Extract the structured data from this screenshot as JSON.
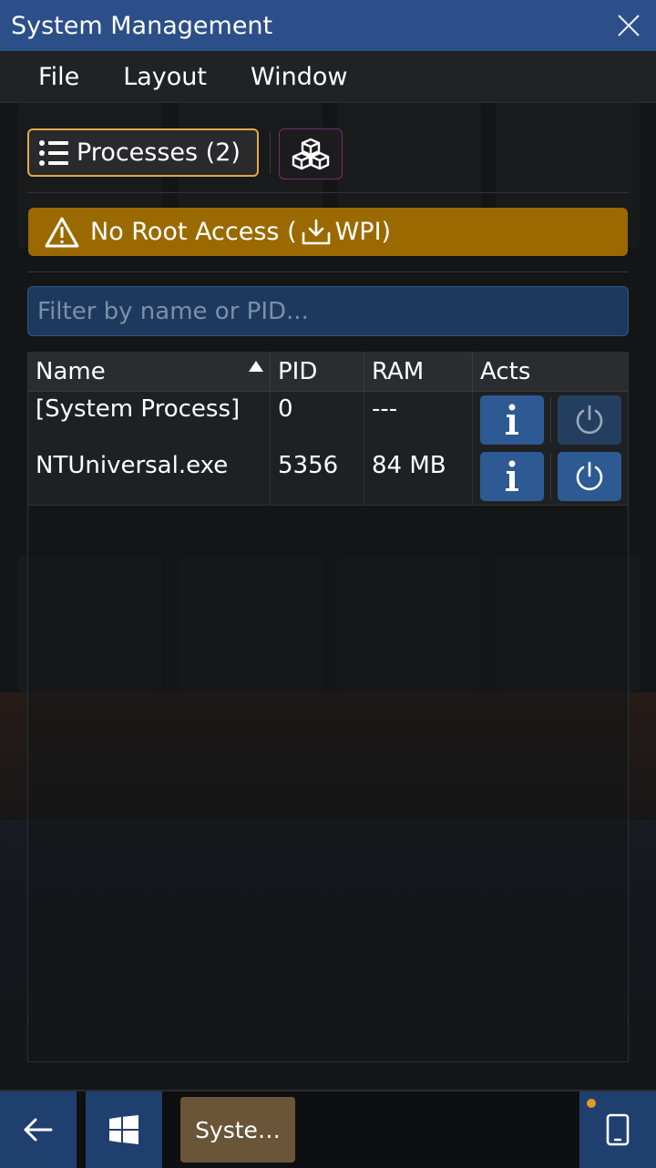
{
  "window": {
    "title": "System Management"
  },
  "menu": {
    "items": [
      "File",
      "Layout",
      "Window"
    ]
  },
  "toolbar": {
    "processes_label": "Processes (2)",
    "packages_icon": "cubes-icon"
  },
  "warning": {
    "text_before": "No Root Access (",
    "text_after": "WPI)"
  },
  "filter": {
    "placeholder": "Filter by name or PID...",
    "value": ""
  },
  "table": {
    "columns": [
      "Name",
      "PID",
      "RAM",
      "Acts"
    ],
    "sort_column": "Name",
    "rows": [
      {
        "name": "[System Process]",
        "pid": "0",
        "ram": "---",
        "kill_enabled": false
      },
      {
        "name": "NTUniversal.exe",
        "pid": "5356",
        "ram": "84 MB",
        "kill_enabled": true
      }
    ]
  },
  "taskbar": {
    "task_label": "Syste…",
    "back_icon": "arrow-left-icon",
    "start_icon": "windows-icon",
    "device_icon": "phone-icon"
  },
  "colors": {
    "titlebar": "#2c4f8a",
    "accent_orange": "#e3a84a",
    "warning": "#9a6a00",
    "button_blue": "#2d5a92"
  }
}
